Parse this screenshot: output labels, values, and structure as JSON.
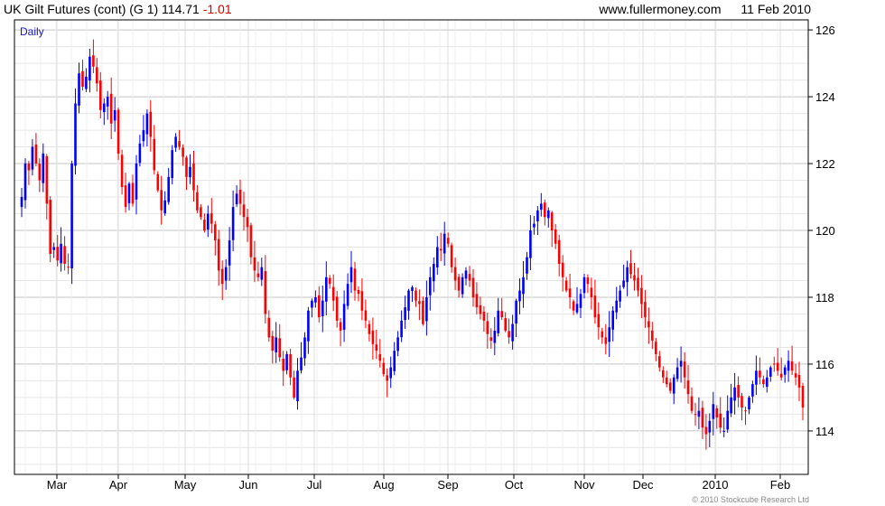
{
  "header": {
    "instrument": "UK Gilt Futures (cont) (G 1)",
    "last": "114.71",
    "change": "-1.01",
    "site": "www.fullermoney.com",
    "date": "11 Feb 2010"
  },
  "footer": "© 2010 Stockcube Research Ltd",
  "colors": {
    "up": "#0000ff",
    "down": "#ff0000",
    "grid": "#d0d0d0",
    "change_text": "#d40000"
  },
  "chart_data": {
    "type": "candlestick",
    "interval_label": "Daily",
    "y_ticks": [
      114,
      116,
      118,
      120,
      122,
      124,
      126
    ],
    "ylim": [
      112.7,
      126.3
    ],
    "x_ticks": [
      "Mar",
      "Apr",
      "May",
      "Jun",
      "Jul",
      "Aug",
      "Sep",
      "Oct",
      "Nov",
      "Dec",
      "2010",
      "Feb"
    ],
    "grid": true,
    "y_axis_side": "right",
    "closes": [
      121.0,
      122.0,
      121.8,
      122.5,
      122.0,
      121.5,
      122.3,
      120.8,
      119.3,
      119.5,
      119.1,
      119.6,
      119.0,
      118.9,
      122.0,
      123.8,
      124.7,
      124.3,
      124.6,
      125.2,
      124.9,
      124.4,
      123.6,
      123.8,
      124.0,
      123.2,
      123.6,
      122.3,
      121.3,
      120.7,
      121.4,
      120.8,
      122.0,
      122.6,
      123.0,
      123.5,
      122.8,
      121.8,
      121.2,
      120.6,
      120.9,
      121.6,
      122.4,
      122.8,
      122.5,
      122.2,
      121.6,
      121.9,
      121.2,
      120.6,
      120.4,
      120.0,
      120.5,
      120.2,
      119.7,
      118.8,
      118.4,
      118.9,
      119.7,
      120.7,
      121.1,
      120.8,
      120.4,
      120.1,
      119.2,
      118.8,
      118.6,
      118.9,
      117.5,
      116.8,
      116.4,
      116.8,
      116.2,
      115.8,
      116.3,
      115.6,
      115.0,
      115.8,
      116.2,
      116.8,
      117.6,
      117.9,
      118.0,
      117.4,
      117.9,
      118.6,
      118.4,
      117.9,
      117.3,
      117.0,
      117.8,
      118.4,
      118.9,
      118.2,
      118.1,
      117.6,
      117.3,
      116.9,
      116.6,
      116.4,
      116.1,
      115.7,
      115.5,
      115.9,
      116.4,
      116.8,
      117.3,
      117.7,
      118.2,
      118.3,
      117.9,
      117.8,
      117.2,
      118.0,
      118.6,
      119.0,
      119.5,
      119.4,
      119.9,
      119.6,
      118.9,
      118.5,
      118.2,
      118.6,
      118.8,
      118.5,
      118.0,
      117.7,
      117.5,
      117.3,
      116.9,
      116.7,
      117.0,
      117.6,
      117.4,
      117.0,
      116.8,
      117.2,
      117.9,
      118.2,
      118.6,
      119.2,
      120.0,
      120.2,
      120.6,
      120.8,
      120.4,
      120.6,
      120.0,
      119.6,
      119.0,
      118.6,
      118.2,
      118.0,
      117.6,
      117.8,
      118.1,
      118.6,
      118.4,
      118.0,
      117.4,
      117.1,
      116.8,
      116.6,
      117.1,
      117.6,
      117.9,
      118.2,
      118.5,
      118.9,
      118.7,
      118.5,
      118.2,
      117.8,
      117.4,
      117.1,
      116.7,
      116.3,
      115.9,
      115.6,
      115.4,
      115.2,
      115.6,
      115.9,
      116.1,
      115.6,
      115.1,
      114.6,
      114.5,
      114.6,
      114.1,
      113.9,
      114.3,
      114.8,
      114.4,
      114.1,
      114.0,
      114.6,
      115.0,
      115.3,
      115.0,
      114.7,
      114.6,
      115.0,
      115.4,
      115.8,
      115.6,
      115.4,
      115.6,
      115.9,
      116.0,
      115.8,
      115.6,
      115.9,
      116.1,
      115.8,
      115.6,
      115.3,
      114.7
    ]
  }
}
